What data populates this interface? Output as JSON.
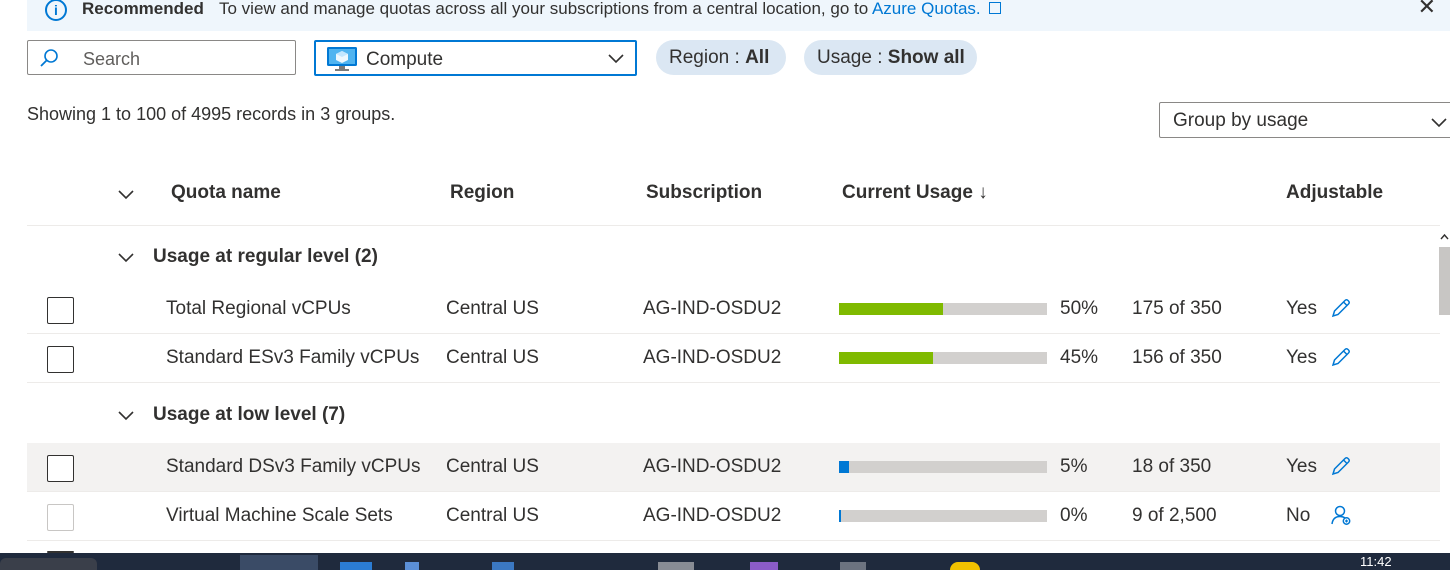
{
  "banner": {
    "title": "Recommended",
    "message": "To view and manage quotas across all your subscriptions from a central location, go to",
    "link": "Azure Quotas."
  },
  "filters": {
    "search_placeholder": "Search",
    "provider_value": "Compute",
    "region_label": "Region : ",
    "region_value": "All",
    "usage_label": "Usage : ",
    "usage_value": "Show all"
  },
  "records_text": "Showing 1 to 100 of 4995 records in 3 groups.",
  "group_by": "Group by usage",
  "columns": {
    "quota_name": "Quota name",
    "region": "Region",
    "subscription": "Subscription",
    "current_usage": "Current Usage ↓",
    "adjustable": "Adjustable"
  },
  "groups": [
    {
      "label": "Usage at regular level (2)",
      "rows": [
        {
          "name": "Total Regional vCPUs",
          "region": "Central US",
          "subscription": "AG-IND-OSDU2",
          "usage_fraction": 0.5,
          "percent": "50%",
          "count": "175 of 350",
          "adjustable": "Yes",
          "action_icon": "edit-pencil-icon",
          "bar_color": "#7fba00"
        },
        {
          "name": "Standard ESv3 Family vCPUs",
          "region": "Central US",
          "subscription": "AG-IND-OSDU2",
          "usage_fraction": 0.45,
          "percent": "45%",
          "count": "156 of 350",
          "adjustable": "Yes",
          "action_icon": "edit-pencil-icon",
          "bar_color": "#7fba00"
        }
      ]
    },
    {
      "label": "Usage at low level (7)",
      "rows": [
        {
          "name": "Standard DSv3 Family vCPUs",
          "region": "Central US",
          "subscription": "AG-IND-OSDU2",
          "usage_fraction": 0.05,
          "percent": "5%",
          "count": "18 of 350",
          "adjustable": "Yes",
          "action_icon": "edit-pencil-icon",
          "bar_color": "#0078d4"
        },
        {
          "name": "Virtual Machine Scale Sets",
          "region": "Central US",
          "subscription": "AG-IND-OSDU2",
          "usage_fraction": 0.0,
          "percent": "0%",
          "count": "9 of 2,500",
          "adjustable": "No",
          "action_icon": "support-request-icon",
          "bar_color": "#0078d4"
        }
      ]
    }
  ],
  "taskbar": {
    "clock": "11:42"
  },
  "colors": {
    "accent": "#0078d4",
    "usage_green": "#7fba00",
    "bar_track": "#d2d0ce",
    "banner_bg": "#eff6fc",
    "pill_bg": "#dbe7f3"
  }
}
